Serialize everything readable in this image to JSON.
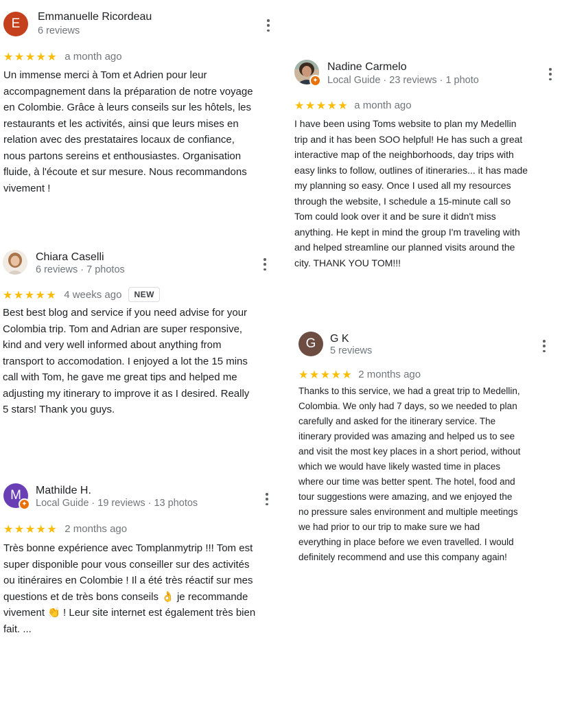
{
  "reviews": [
    {
      "avatar_initial": "E",
      "avatar_color": "#c5401c",
      "name": "Emmanuelle Ricordeau",
      "meta": "6 reviews",
      "stars": "★★★★★",
      "date": "a month ago",
      "text": "Un immense merci à Tom et Adrien pour leur\naccompagnement dans la préparation de notre voyage\nen Colombie. Grâce à leurs conseils sur les hôtels, les\nrestaurants et les activités, ainsi que leurs mises en\nrelation avec des prestataires locaux de confiance,\nnous partons sereins et enthousiastes. Organisation\nfluide, à l'écoute et sur mesure. Nous recommandons\nvivement !"
    },
    {
      "avatar_icon": "profile-photo",
      "name": "Nadine Carmelo",
      "meta": "Local Guide · 23 reviews · 1 photo",
      "stars": "★★★★★",
      "date": "a month ago",
      "text": "I have been using Toms website to plan my Medellin\ntrip and it has been SOO helpful! He has such a great\ninteractive map of the neighborhoods, day trips with\neasy links to follow, outlines of itineraries... it has made\nmy planning so easy. Once I used all my resources\nthrough the website, I schedule a 15-minute call so\nTom could look over it and be sure it didn't miss\nanything. He kept in mind the group I'm traveling with\nand helped streamline our planned visits around the\ncity. THANK YOU TOM!!!"
    },
    {
      "avatar_icon": "profile-photo",
      "name": "Chiara Caselli",
      "meta": "6 reviews · 7 photos",
      "stars": "★★★★★",
      "date": "4 weeks ago",
      "badge": "NEW",
      "text": "Best best blog and service if you need advise for your\nColombia trip. Tom and Adrian are super responsive,\nkind and very well informed about anything from\ntransport to accomodation. I enjoyed a lot the 15 mins\ncall with Tom, he gave me great tips and helped me\nadjusting my itinerary to improve it as I desired. Really\n5 stars! Thank you guys."
    },
    {
      "avatar_initial": "G",
      "avatar_color": "#6d4c41",
      "name": "G K",
      "meta": "5 reviews",
      "stars": "★★★★★",
      "date": "2 months ago",
      "text": "Thanks to this service, we had a great trip to Medellin,\nColombia. We only had 7 days, so we needed to plan\ncarefully and asked for the itinerary service. The\nitinerary provided was amazing and helped us to see\nand visit the most key places in a short period, without\nwhich we would have likely wasted time in places\nwhere our time was better spent. The hotel, food and\ntour suggestions were amazing, and we enjoyed the\nno pressure sales environment and multiple meetings\nwe had prior to our trip to make sure we had\neverything in place before we even travelled. I would\ndefinitely recommend and use this company again!"
    },
    {
      "avatar_initial": "M",
      "avatar_color": "#6a3fb5",
      "name": "Mathilde H.",
      "meta": "Local Guide · 19 reviews · 13 photos",
      "stars": "★★★★★",
      "date": "2 months ago",
      "text": "Très bonne expérience avec Tomplanmytrip !!! Tom est\nsuper disponible pour vous conseiller sur des activités\nou itinéraires en Colombie ! Il a été très réactif sur mes\nquestions et de très bons conseils 👌 je recommande\nvivement 👏 ! Leur site internet est également très bien\nfait. ..."
    }
  ],
  "colors": {
    "star": "#fbbc04",
    "meta": "#70757a",
    "local_guide_badge": "#e8710a"
  }
}
